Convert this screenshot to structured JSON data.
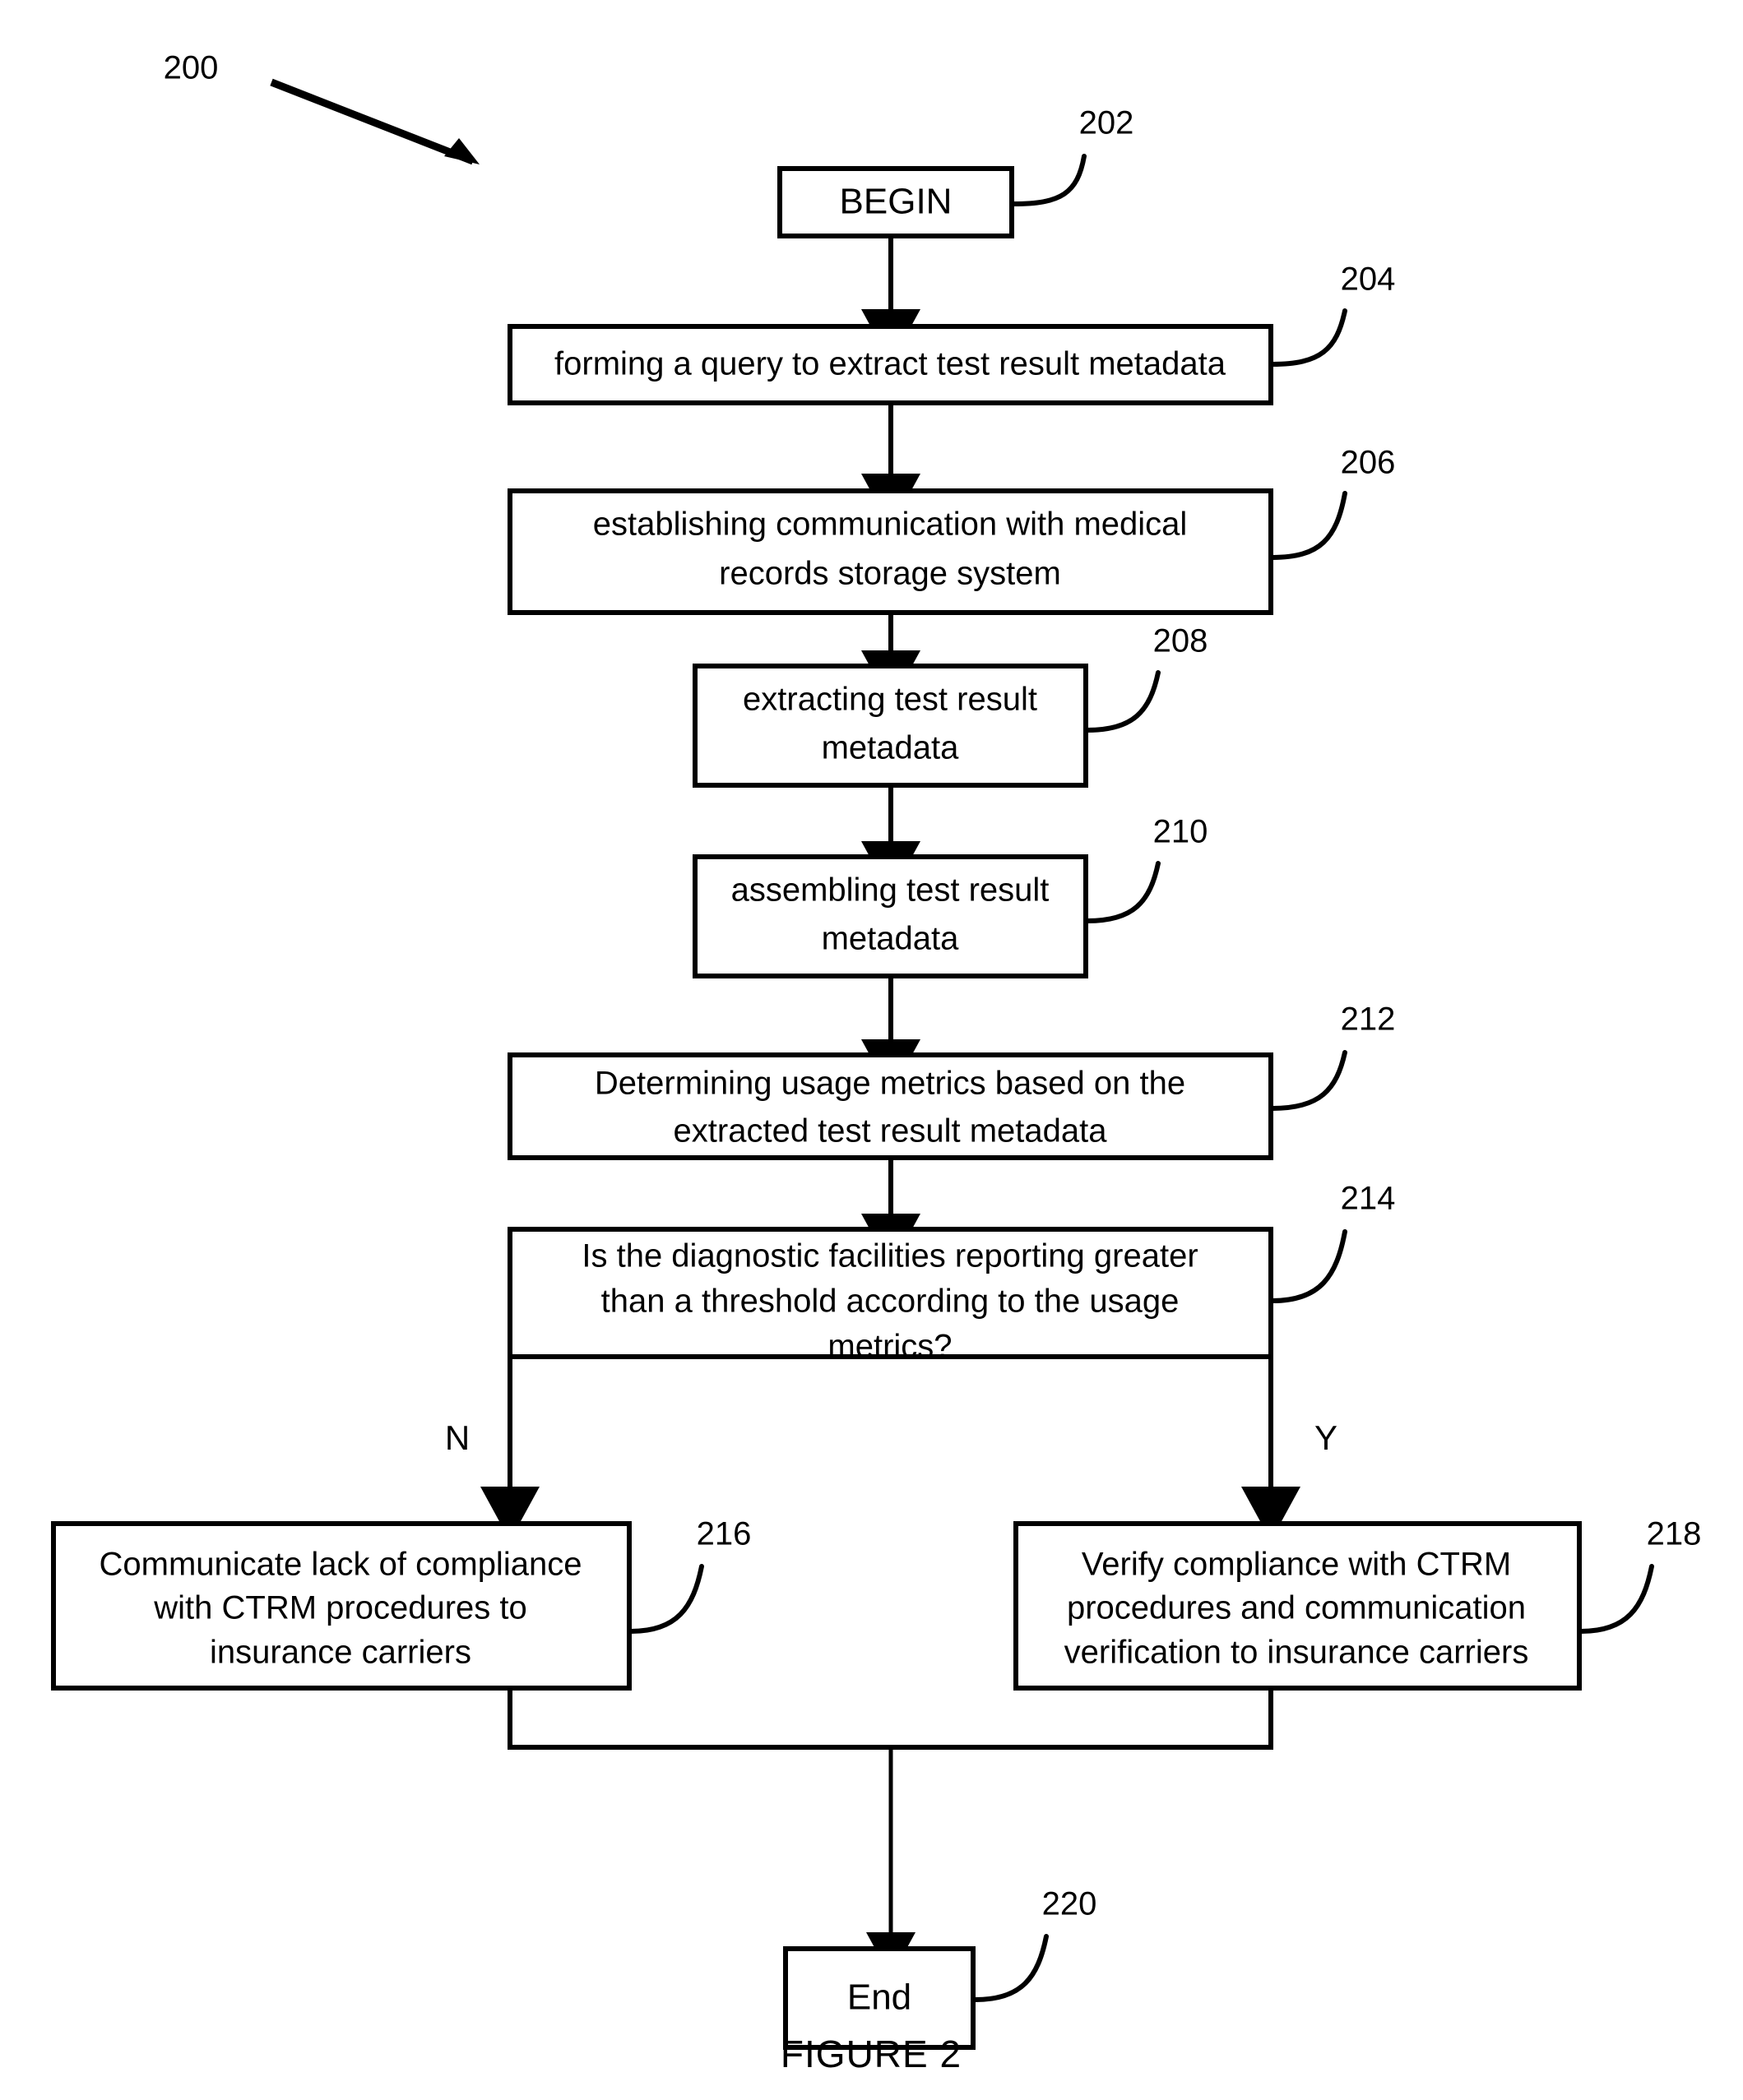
{
  "figure": {
    "caption": "FIGURE 2",
    "diagram_ref": "200"
  },
  "nodes": {
    "begin": {
      "ref": "202",
      "label": "BEGIN",
      "shape": "terminal"
    },
    "form_query": {
      "ref": "204",
      "line1": "forming a query to extract test result metadata",
      "shape": "process"
    },
    "establish_comm": {
      "ref": "206",
      "line1": "establishing communication with medical",
      "line2": "records storage system",
      "shape": "process"
    },
    "extract_metadata": {
      "ref": "208",
      "line1": "extracting test result",
      "line2": "metadata",
      "shape": "process"
    },
    "assemble_metadata": {
      "ref": "210",
      "line1": "assembling test result",
      "line2": "metadata",
      "shape": "process"
    },
    "determine_usage": {
      "ref": "212",
      "line1": "Determining usage metrics based on the",
      "line2": "extracted test result metadata",
      "shape": "process"
    },
    "decision_threshold": {
      "ref": "214",
      "line1": "Is the diagnostic facilities reporting greater",
      "line2": "than a threshold according to the usage",
      "line3": "metrics?",
      "shape": "decision"
    },
    "communicate_lack": {
      "ref": "216",
      "line1": "Communicate lack of compliance",
      "line2": "with CTRM procedures to",
      "line3": "insurance carriers",
      "shape": "process"
    },
    "verify_compliance": {
      "ref": "218",
      "line1": "Verify compliance with CTRM",
      "line2": "procedures and communication",
      "line3": "verification to insurance carriers",
      "shape": "process"
    },
    "end": {
      "ref": "220",
      "label": "End",
      "shape": "terminal"
    }
  },
  "branches": {
    "no_label": "N",
    "yes_label": "Y"
  },
  "colors": {
    "stroke": "#000000",
    "fill": "#ffffff",
    "background": "#ffffff"
  }
}
